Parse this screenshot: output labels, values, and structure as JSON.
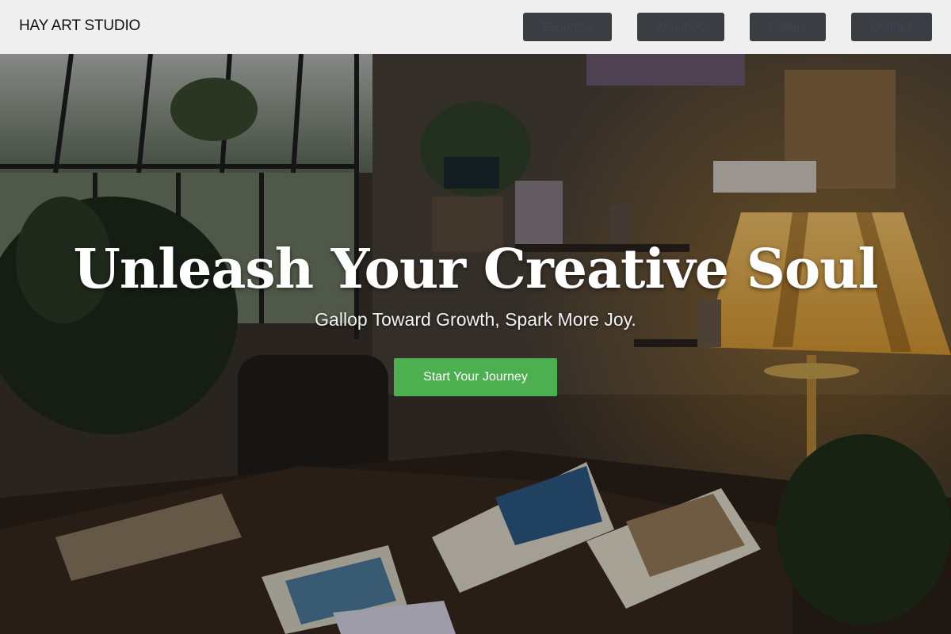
{
  "brand": {
    "name": "HAY ART STUDIO"
  },
  "nav": {
    "items": [
      {
        "label": "Expertise"
      },
      {
        "label": "About Us"
      },
      {
        "label": "Gallery"
      },
      {
        "label": "Contact"
      }
    ]
  },
  "hero": {
    "title": "Unleash Your Creative Soul",
    "subtitle": "Gallop Toward Growth, Spark More Joy.",
    "cta_label": "Start Your Journey",
    "background_icon": "art-studio-photo"
  },
  "colors": {
    "header_bg": "#efefef",
    "nav_button_bg": "#3a3d42",
    "nav_button_text": "#3c4653",
    "cta_bg": "#4caf50",
    "cta_text": "#ffffff"
  }
}
